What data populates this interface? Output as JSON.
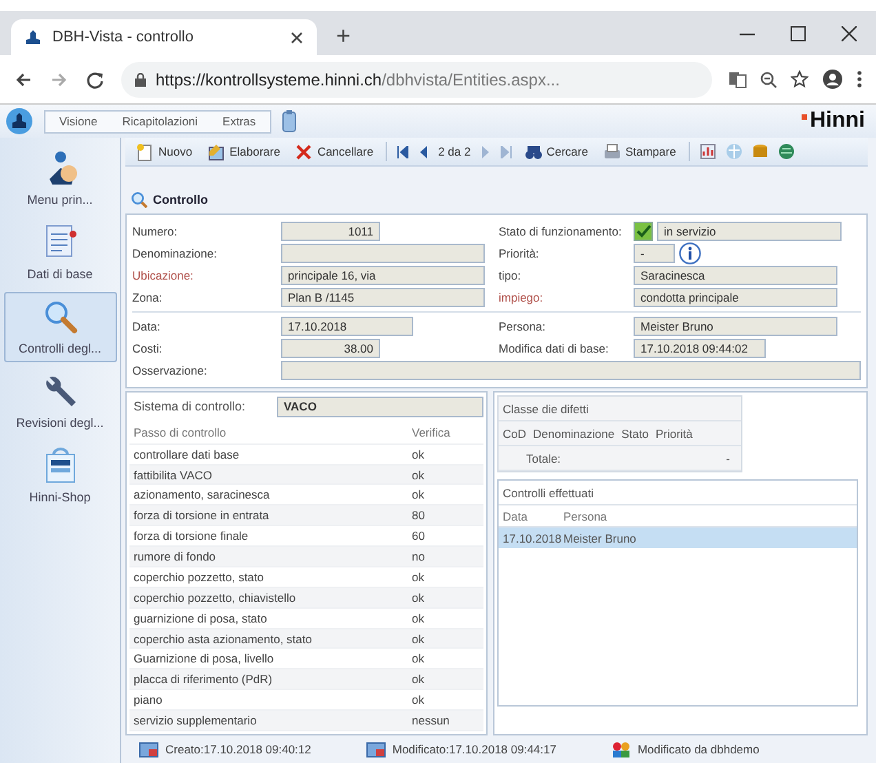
{
  "browser": {
    "tab_title": "DBH-Vista - controllo",
    "new_tab": "+",
    "url_host": "https://kontrollsysteme.hinni.ch",
    "url_path": "/dbhvista/Entities.aspx..."
  },
  "app": {
    "menus": [
      "Visione",
      "Ricapitolazioni",
      "Extras"
    ],
    "brand": "Hinni"
  },
  "toolbar": {
    "actions": [
      {
        "kind": "new",
        "label": "Nuovo"
      },
      {
        "kind": "edit",
        "label": "Elaborare"
      },
      {
        "kind": "delete",
        "label": "Cancellare"
      }
    ],
    "pager": "2 da 2",
    "tools": [
      {
        "kind": "search",
        "label": "Cercare"
      },
      {
        "kind": "print",
        "label": "Stampare"
      }
    ]
  },
  "sidebar": {
    "items": [
      {
        "kind": "menu",
        "label": "Menu prin...",
        "selected": false
      },
      {
        "kind": "data",
        "label": "Dati di base",
        "selected": false
      },
      {
        "kind": "search",
        "label": "Controlli degl...",
        "selected": true
      },
      {
        "kind": "tools",
        "label": "Revisioni degl...",
        "selected": false
      },
      {
        "kind": "shop",
        "label": "Hinni-Shop",
        "selected": false
      }
    ]
  },
  "section_title": "Controllo",
  "form": {
    "groups": [
      {
        "left": [
          {
            "label": "Numero:",
            "value": "1011",
            "kind": "number",
            "required": false
          },
          {
            "label": "Denominazione:",
            "kind": "text",
            "required": false
          },
          {
            "label": "Ubicazione:",
            "value": "principale 16, via",
            "kind": "text",
            "required": true
          },
          {
            "label": "Zona:",
            "value": "Plan B /1145",
            "kind": "text",
            "required": false
          }
        ],
        "right": [
          {
            "label": "Stato di funzionamento:",
            "value": "in servizio",
            "kind": "status",
            "checked": true,
            "required": false
          },
          {
            "label": "Priorità:",
            "value": "-",
            "kind": "priority",
            "required": false
          },
          {
            "label": "tipo:",
            "value": "Saracinesca",
            "kind": "text",
            "required": false
          },
          {
            "label": "impiego:",
            "value": "condotta principale",
            "kind": "text",
            "required": true
          }
        ]
      },
      {
        "left": [
          {
            "label": "Data:",
            "value": "17.10.2018",
            "kind": "date",
            "required": false
          },
          {
            "label": "Costi:",
            "value": "38.00",
            "kind": "number",
            "required": false
          }
        ],
        "right": [
          {
            "label": "Persona:",
            "value": "Meister Bruno",
            "kind": "text",
            "required": false
          },
          {
            "label": "Modifica dati di base:",
            "value": "17.10.2018 09:44:02",
            "kind": "date",
            "required": false
          }
        ]
      }
    ],
    "remark": {
      "label": "Osservazione:"
    }
  },
  "steps": {
    "system_label": "Sistema di controllo:",
    "system_value": "VACO",
    "columns": [
      "Passo di controllo",
      "Verifica"
    ],
    "rows": [
      [
        "controllare dati base",
        "ok"
      ],
      [
        "fattibilita VACO",
        "ok"
      ],
      [
        "azionamento, saracinesca",
        "ok"
      ],
      [
        "forza di torsione in entrata",
        "80"
      ],
      [
        "forza di torsione finale",
        "60"
      ],
      [
        "rumore di fondo",
        "no"
      ],
      [
        "coperchio pozzetto, stato",
        "ok"
      ],
      [
        "coperchio pozzetto, chiavistello",
        "ok"
      ],
      [
        "guarnizione di posa, stato",
        "ok"
      ],
      [
        "coperchio asta azionamento, stato",
        "ok"
      ],
      [
        "Guarnizione di posa, livello",
        "ok"
      ],
      [
        "placca di riferimento (PdR)",
        "ok"
      ],
      [
        "piano",
        "ok"
      ],
      [
        "servizio supplementario",
        "nessun"
      ]
    ]
  },
  "defects": {
    "title": "Classe die difetti",
    "columns": [
      "CoD",
      "Denominazione",
      "Stato",
      "Priorità"
    ],
    "total_label": "Totale:",
    "total_value": "-"
  },
  "done": {
    "title": "Controlli effettuati",
    "columns": [
      "Data",
      "Persona"
    ],
    "rows": [
      {
        "date": "17.10.2018",
        "person": "Meister Bruno",
        "selected": true
      }
    ]
  },
  "status_bar": {
    "items": [
      {
        "kind": "created",
        "text": "Creato:17.10.2018 09:40:12"
      },
      {
        "kind": "modified",
        "text": "Modificato:17.10.2018 09:44:17"
      },
      {
        "kind": "user",
        "text": "Modificato da dbhdemo"
      }
    ]
  }
}
